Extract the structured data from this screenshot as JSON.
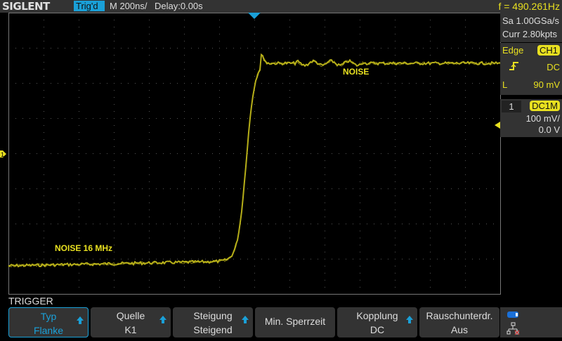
{
  "header": {
    "brand": "SIGLENT",
    "trigger_status": "Trig'd",
    "timebase": "M 200ns/",
    "delay": "Delay:0.00s",
    "frequency": "f = 490.261Hz"
  },
  "acquisition": {
    "sample_rate": "Sa 1.00GSa/s",
    "memory": "Curr 2.80kpts"
  },
  "trigger_info": {
    "type": "Edge",
    "source": "CH1",
    "slope_icon": "rising-edge-icon",
    "coupling": "DC",
    "level_label": "L",
    "level": "90 mV"
  },
  "channel": {
    "number": "1",
    "coupling": "DC1M",
    "scale": "100 mV/",
    "offset": "0.0 V",
    "color": "#e8e020"
  },
  "annotations": {
    "high": "NOISE",
    "low": "NOISE 16 MHz"
  },
  "menu": {
    "title": "TRIGGER",
    "buttons": [
      {
        "top": "Typ",
        "bottom": "Flanke",
        "arrow": true,
        "selected": true
      },
      {
        "top": "Quelle",
        "bottom": "K1",
        "arrow": true
      },
      {
        "top": "Steigung",
        "bottom": "Steigend",
        "arrow": true
      },
      {
        "top": "Min. Sperrzeit",
        "bottom": "",
        "arrow": false
      },
      {
        "top": "Kopplung",
        "bottom": "DC",
        "arrow": true
      },
      {
        "top": "Rauschunterdr.",
        "bottom": "Aus",
        "arrow": false
      }
    ]
  },
  "status_icons": [
    "usb-icon",
    "network-disconnected-icon"
  ],
  "colors": {
    "accent": "#1aa0d8",
    "trace": "#e8e020",
    "panel": "#333333"
  }
}
